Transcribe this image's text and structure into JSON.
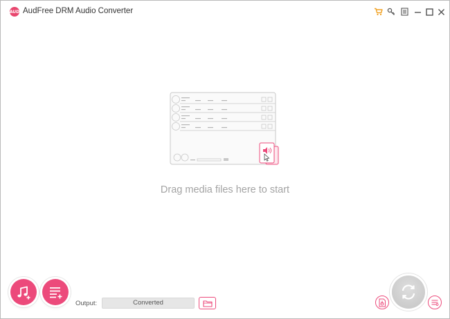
{
  "app": {
    "logo_text": "AUD",
    "title": "AudFree DRM Audio Converter"
  },
  "titlebar": {
    "icons": [
      "cart-icon",
      "key-icon",
      "menu-icon",
      "minimize-icon",
      "maximize-icon",
      "close-icon"
    ]
  },
  "drop_area": {
    "hint": "Drag media files here to start"
  },
  "bottom": {
    "output_label": "Output:",
    "output_value": "Converted"
  },
  "colors": {
    "accent": "#ec4a7b",
    "cart": "#f0a020",
    "hint_text": "#a3a3a3",
    "convert_button": "#cfcfcf"
  }
}
